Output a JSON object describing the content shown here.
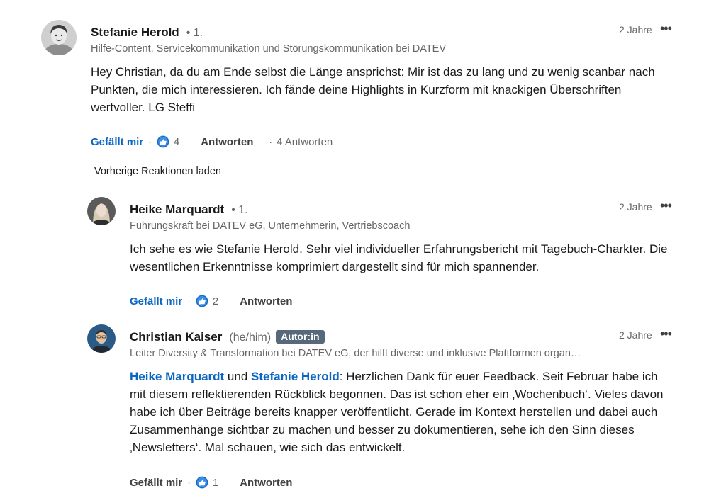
{
  "comments": [
    {
      "name": "Stefanie Herold",
      "degree": "• 1.",
      "headline": "Hilfe-Content, Servicekommunikation und Störungskommunikation bei DATEV",
      "time": "2 Jahre",
      "body": "Hey Christian, da du am Ende selbst die Länge ansprichst: Mir ist das zu lang und zu wenig scanbar nach Punkten, die mich interessieren. Ich fände deine Highlights in Kurzform mit knackigen Überschriften wertvoller. LG Steffi",
      "like_label": "Gefällt mir",
      "like_count": "4",
      "reply_label": "Antworten",
      "replies_count": "4 Antworten"
    },
    {
      "name": "Heike Marquardt",
      "degree": "• 1.",
      "headline": "Führungskraft bei DATEV eG, Unternehmerin, Vertriebscoach",
      "time": "2 Jahre",
      "body": "Ich sehe es wie Stefanie Herold. Sehr viel individueller Erfahrungsbericht mit Tagebuch-Charkter. Die wesentlichen Erkenntnisse komprimiert dargestellt sind für mich spannender.",
      "like_label": "Gefällt mir",
      "like_count": "2",
      "reply_label": "Antworten"
    },
    {
      "name": "Christian Kaiser",
      "pronouns": "(he/him)",
      "badge": "Autor:in",
      "headline": "Leiter Diversity & Transformation bei DATEV eG, der hilft diverse und inklusive Plattformen organ…",
      "time": "2 Jahre",
      "mention1": "Heike Marquardt",
      "connector": " und ",
      "mention2": "Stefanie Herold",
      "body": ": Herzlichen Dank für euer Feedback. Seit Februar habe ich mit diesem reflektierenden Rückblick begonnen. Das ist schon eher ein ‚Wochenbuch‘. Vieles davon habe ich über Beiträge bereits knapper veröffentlicht. Gerade im Kontext herstellen und dabei auch Zusammenhänge sichtbar zu machen und besser zu dokumentieren, sehe ich den Sinn dieses ‚Newsletters‘. Mal schauen, wie sich das entwickelt.",
      "like_label": "Gefällt mir",
      "like_count": "1",
      "reply_label": "Antworten"
    }
  ],
  "load_previous": "Vorherige Reaktionen laden",
  "more_menu": "•••",
  "colors": {
    "link": "#0a66c2",
    "badge": "#56687a",
    "muted": "#666666"
  },
  "icons": [
    "like-icon",
    "more-options-icon"
  ]
}
